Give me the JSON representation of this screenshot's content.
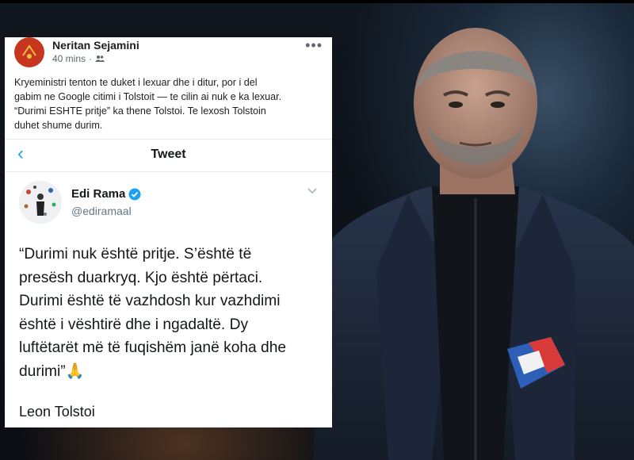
{
  "post": {
    "author": "Neritan Sejamini",
    "time": "40 mins",
    "privacy_icon": "friends-icon",
    "more_icon": "more-dots-icon",
    "lines": [
      "Kryeministri tenton te duket i lexuar dhe i ditur, por i del",
      "gabim ne Google citimi i Tolstoit — te cilin ai nuk e ka lexuar.",
      "“Durimi ESHTE pritje” ka thene Tolstoi. Te lexosh Tolstoin",
      "duhet shume durim."
    ]
  },
  "tweet": {
    "nav_title": "Tweet",
    "back_icon": "chevron-left-icon",
    "name": "Edi Rama",
    "handle": "@ediramaal",
    "verified_icon": "verified-badge-icon",
    "menu_icon": "chevron-down-icon",
    "body_lines": [
      "“Durimi nuk është pritje. S’është të",
      "presësh duarkryq. Kjo është përtaci.",
      "Durimi është të vazhdosh kur vazhdimi",
      "është i vështirë dhe i ngadaltë. Dy",
      "luftëtarët më të fuqishëm janë koha dhe",
      "durimi”🙏"
    ],
    "attribution": "Leon Tolstoi"
  },
  "colors": {
    "twitter_blue": "#1da1f2",
    "fb_avatar": "#c7361e"
  }
}
